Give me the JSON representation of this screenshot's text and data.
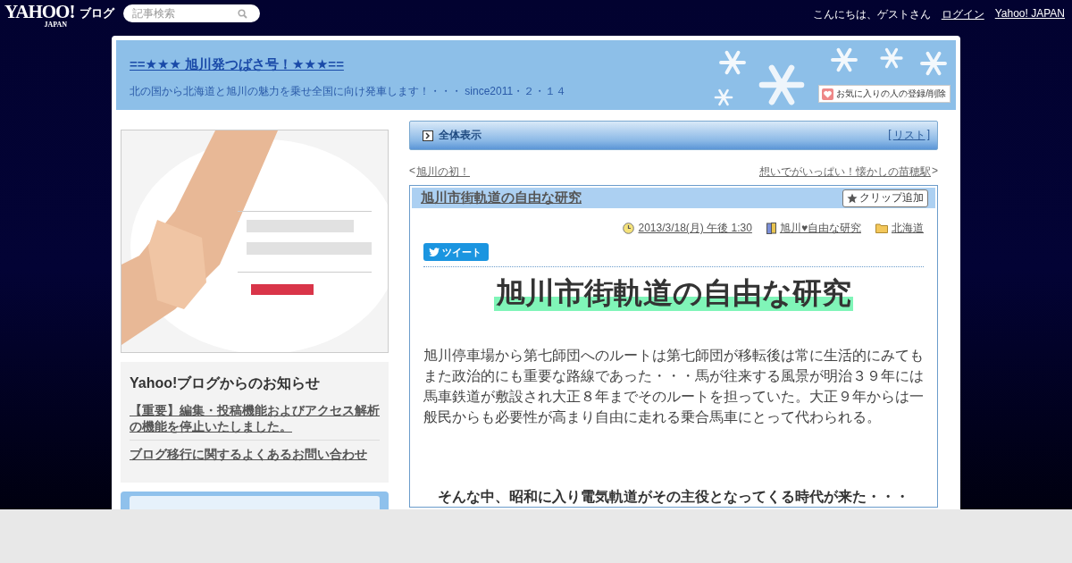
{
  "topbar": {
    "logo": "YAHOO!",
    "logo_sub": "JAPAN",
    "service": "ブログ",
    "search": {
      "placeholder": "記事検索"
    },
    "greeting": "こんにちは、ゲストさん",
    "links": [
      "ログイン",
      "Yahoo! JAPAN"
    ]
  },
  "blog_header": {
    "title": "==★★★ 旭川発つばさ号！★★★==",
    "description": "北の国から北海道と旭川の魅力を乗せ全国に向け発車します！・・・ since2011・２・１４",
    "favorite_button": "お気に入りの人の登録/削除"
  },
  "sidebar": {
    "notice": {
      "title": "Yahoo!ブログからのお知らせ",
      "links": [
        "【重要】編集・投稿機能およびアクセス解析の機能を停止いたしました。",
        "ブログ移行に関するよくあるお問い合わせ"
      ]
    }
  },
  "article_bar": {
    "label": "全体表示",
    "list_link": "リスト",
    "list_open": "[",
    "list_close": "]"
  },
  "pager": {
    "prev_mark": "<",
    "prev": "旭川の初！",
    "next": "想いでがいっぱい！懐かしの苗穂駅",
    "next_mark": ">"
  },
  "post": {
    "title": "旭川市街軌道の自由な研究",
    "clip_button": "クリップ追加",
    "date": "2013/3/18(月) 午後 1:30",
    "book": "旭川♥自由な研究",
    "category": "北海道",
    "tweet_button": "ツイート",
    "heading": "旭川市街軌道の自由な研究",
    "body": "旭川停車場から第七師団へのルートは第七師団が移転後は常に生活的にみてもまた政治的にも重要な路線であった・・・馬が往来する風景が明治３９年には馬車鉄道が敷設され大正８年までそのルートを担っていた。大正９年からは一般民からも必要性が高まり自由に走れる乗合馬車にとって代わられる。",
    "subheading": "そんな中、昭和に入り電気軌道がその主役となってくる時代が来た・・・"
  }
}
